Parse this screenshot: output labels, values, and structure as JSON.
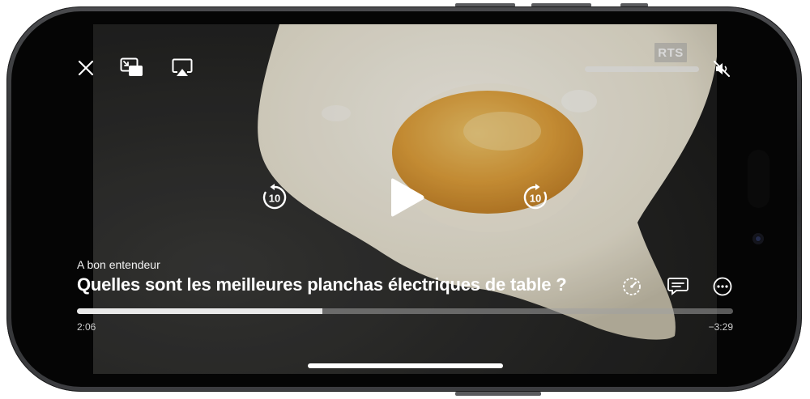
{
  "player": {
    "brand": "RTS",
    "show_name": "A bon entendeur",
    "episode_title": "Quelles sont les meilleures planchas électriques de table ?",
    "elapsed": "2:06",
    "remaining": "−3:29",
    "progress_fraction": 0.374,
    "volume_fraction": 1.0,
    "skip_seconds": "10"
  },
  "icons": {
    "close": "close-icon",
    "picture_in_picture": "pip-icon",
    "airplay": "airplay-icon",
    "mute": "speaker-muted-icon",
    "rewind": "rewind-10-icon",
    "play": "play-icon",
    "forward": "forward-10-icon",
    "speed": "playback-speed-icon",
    "subtitles": "subtitles-icon",
    "more": "more-icon"
  },
  "colors": {
    "controls": "#ffffff",
    "progress_fill": "#e9e9e9",
    "progress_track": "#a0a0a0"
  }
}
